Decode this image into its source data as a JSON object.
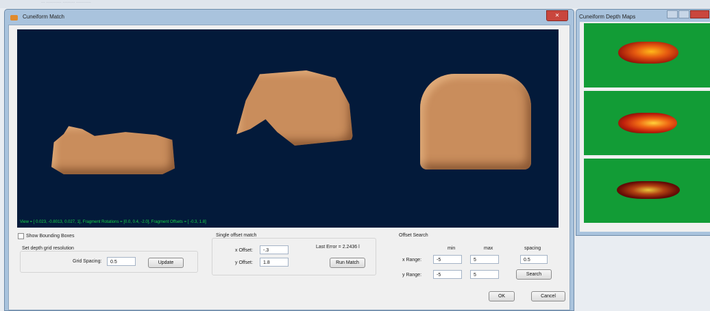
{
  "main_window": {
    "title": "Cuneiform Match",
    "close_glyph": "✕",
    "view_readout": "View = [ 0.023, -0.8013, 0.027, 1], Fragment Rotations = [0.0, 0.4, -2.0], Fragment Offsets = [ -0.3, 1.8]",
    "show_bounding_boxes_label": "Show Bounding Boxes",
    "depth_grid": {
      "section_label": "Set depth grid resolution",
      "grid_spacing_label": "Grid Spacing:",
      "grid_spacing_value": "0.5",
      "update_label": "Update"
    },
    "single_offset": {
      "section_label": "Single offset match",
      "x_offset_label": "x Offset:",
      "x_offset_value": "-.3",
      "y_offset_label": "y Offset:",
      "y_offset_value": "1.8",
      "last_error": "Last Error = 2.2436 l",
      "run_match_label": "Run Match"
    },
    "offset_search": {
      "section_label": "Offset Search",
      "min_label": "min",
      "max_label": "max",
      "spacing_label": "spacing",
      "x_range_label": "x Range:",
      "x_min": "-5",
      "x_max": "5",
      "spacing_value": "0.5",
      "y_range_label": "y Range:",
      "y_min": "-5",
      "y_max": "5",
      "search_label": "Search"
    },
    "ok_label": "OK",
    "cancel_label": "Cancel"
  },
  "depth_window": {
    "title": "Cuneiform Depth Maps"
  },
  "background_window": {
    "title": "···  ···········  ·········  ···········"
  },
  "colors": {
    "viewport_bg": "#031a3a",
    "tablet": "#c98d5c",
    "readout_text": "#17d64a",
    "depth_bg": "#129c36"
  }
}
